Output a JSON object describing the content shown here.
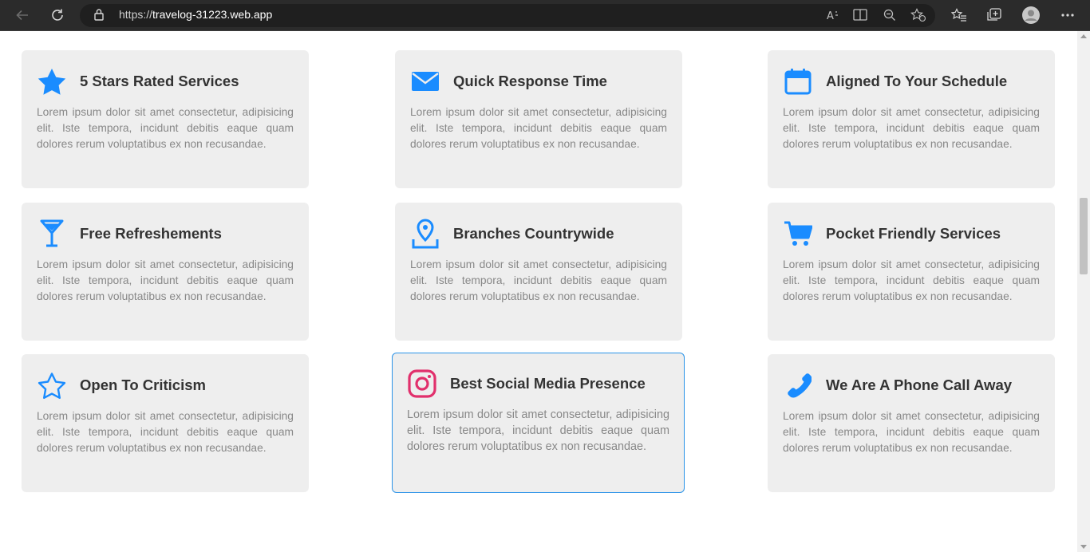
{
  "browser": {
    "url_scheme": "https://",
    "url_host": "travelog-31223.web.app"
  },
  "features": [
    {
      "title": "5 Stars Rated Services",
      "icon": "star-icon",
      "text": "Lorem ipsum dolor sit amet consectetur, adipisicing elit. Iste tempora, incidunt debitis eaque quam dolores rerum voluptatibus ex non recusandae."
    },
    {
      "title": "Quick Response Time",
      "icon": "envelope-icon",
      "text": "Lorem ipsum dolor sit amet consectetur, adipisicing elit. Iste tempora, incidunt debitis eaque quam dolores rerum voluptatibus ex non recusandae."
    },
    {
      "title": "Aligned To Your Schedule",
      "icon": "calendar-icon",
      "text": "Lorem ipsum dolor sit amet consectetur, adipisicing elit. Iste tempora, incidunt debitis eaque quam dolores rerum voluptatibus ex non recusandae."
    },
    {
      "title": "Free Refreshements",
      "icon": "cocktail-icon",
      "text": "Lorem ipsum dolor sit amet consectetur, adipisicing elit. Iste tempora, incidunt debitis eaque quam dolores rerum voluptatibus ex non recusandae."
    },
    {
      "title": "Branches Countrywide",
      "icon": "map-pin-icon",
      "text": "Lorem ipsum dolor sit amet consectetur, adipisicing elit. Iste tempora, incidunt debitis eaque quam dolores rerum voluptatibus ex non recusandae."
    },
    {
      "title": "Pocket Friendly Services",
      "icon": "cart-icon",
      "text": "Lorem ipsum dolor sit amet consectetur, adipisicing elit. Iste tempora, incidunt debitis eaque quam dolores rerum voluptatibus ex non recusandae."
    },
    {
      "title": "Open To Criticism",
      "icon": "star-outline-icon",
      "text": "Lorem ipsum dolor sit amet consectetur, adipisicing elit. Iste tempora, incidunt debitis eaque quam dolores rerum voluptatibus ex non recusandae."
    },
    {
      "title": "Best Social Media Presence",
      "icon": "instagram-icon",
      "text": "Lorem ipsum dolor sit amet consectetur, adipisicing elit. Iste tempora, incidunt debitis eaque quam dolores rerum voluptatibus ex non recusandae."
    },
    {
      "title": "We Are A Phone Call Away",
      "icon": "phone-icon",
      "text": "Lorem ipsum dolor sit amet consectetur, adipisicing elit. Iste tempora, incidunt debitis eaque quam dolores rerum voluptatibus ex non recusandae."
    }
  ],
  "colors": {
    "accent": "#1a8cff",
    "instagram": "#e1306c",
    "card_bg": "#eeeeee",
    "hover_border": "#2a93e8"
  }
}
